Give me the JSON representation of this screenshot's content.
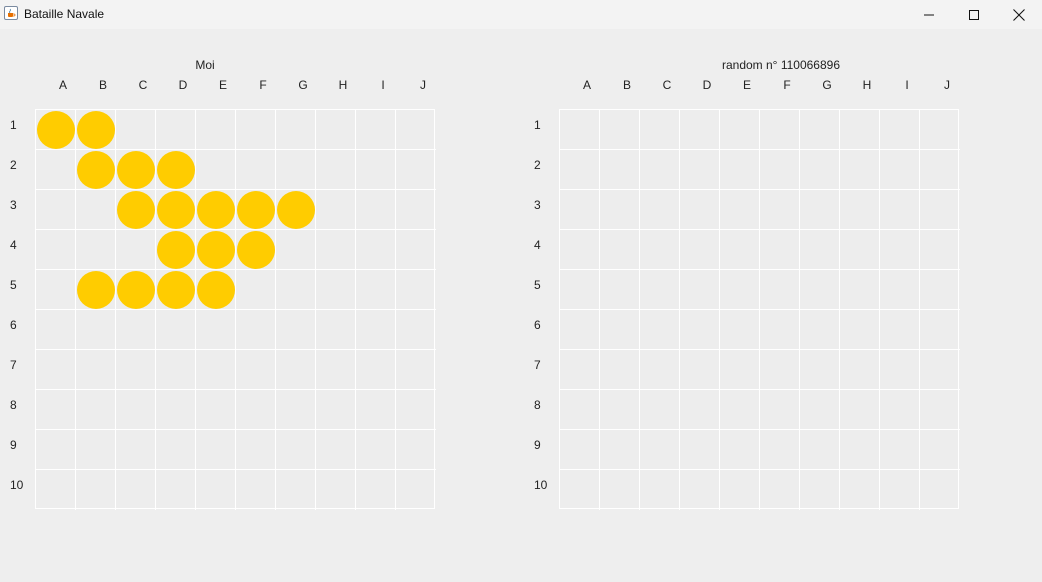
{
  "window": {
    "title": "Bataille Navale",
    "app_icon": "java-cup-icon",
    "controls": [
      "minimize-icon",
      "maximize-icon",
      "close-icon"
    ]
  },
  "columns": [
    "A",
    "B",
    "C",
    "D",
    "E",
    "F",
    "G",
    "H",
    "I",
    "J"
  ],
  "rows": [
    "1",
    "2",
    "3",
    "4",
    "5",
    "6",
    "7",
    "8",
    "9",
    "10"
  ],
  "colors": {
    "ship": "#ffcc00",
    "grid_line": "#ffffff",
    "background": "#eeeeee"
  },
  "player_board": {
    "title": "Moi",
    "ships": [
      {
        "row": 1,
        "col": 1
      },
      {
        "row": 1,
        "col": 2
      },
      {
        "row": 2,
        "col": 2
      },
      {
        "row": 2,
        "col": 3
      },
      {
        "row": 2,
        "col": 4
      },
      {
        "row": 3,
        "col": 3
      },
      {
        "row": 3,
        "col": 4
      },
      {
        "row": 3,
        "col": 5
      },
      {
        "row": 3,
        "col": 6
      },
      {
        "row": 3,
        "col": 7
      },
      {
        "row": 4,
        "col": 4
      },
      {
        "row": 4,
        "col": 5
      },
      {
        "row": 4,
        "col": 6
      },
      {
        "row": 5,
        "col": 2
      },
      {
        "row": 5,
        "col": 3
      },
      {
        "row": 5,
        "col": 4
      },
      {
        "row": 5,
        "col": 5
      }
    ]
  },
  "opponent_board": {
    "title": "random n° 110066896",
    "ships": []
  }
}
